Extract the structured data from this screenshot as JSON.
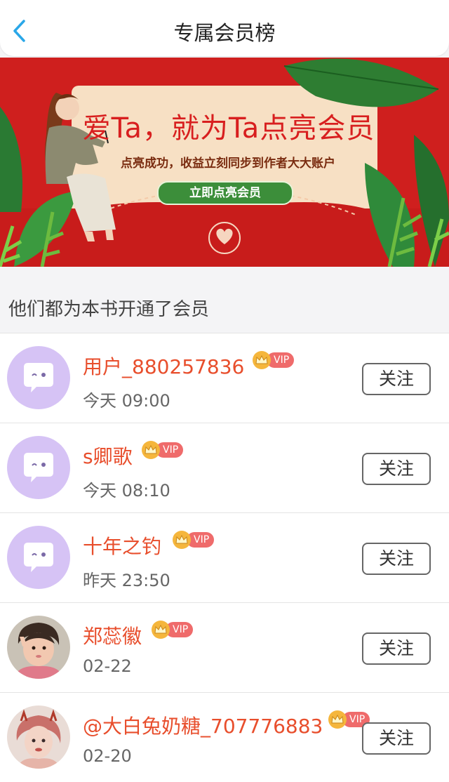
{
  "header": {
    "title": "专属会员榜"
  },
  "banner": {
    "headline": "爱Ta，就为Ta点亮会员",
    "subtitle": "点亮成功，收益立刻同步到作者大大账户",
    "cta": "立即点亮会员"
  },
  "section": {
    "title": "他们都为本书开通了会员"
  },
  "members": [
    {
      "name": "用户_880257836",
      "time": "今天 09:00",
      "vip": "VIP",
      "follow": "关注",
      "avatar": "default-avatar"
    },
    {
      "name": "s卿歌",
      "time": "今天 08:10",
      "vip": "VIP",
      "follow": "关注",
      "avatar": "default-avatar"
    },
    {
      "name": "十年之钓",
      "time": "昨天 23:50",
      "vip": "VIP",
      "follow": "关注",
      "avatar": "default-avatar"
    },
    {
      "name": "郑蕊徽",
      "time": "02-22",
      "vip": "VIP",
      "follow": "关注",
      "avatar": "photo-avatar"
    },
    {
      "name": "@大白兔奶糖_707776883",
      "time": "02-20",
      "vip": "VIP",
      "follow": "关注",
      "avatar": "photo-avatar"
    }
  ],
  "colors": {
    "accent_name": "#e84e2c",
    "banner_red": "#cf1f1e",
    "vip_tag": "#ef6b6b",
    "crown": "#f5b63c",
    "avatar_purple": "#d6c3f5"
  }
}
